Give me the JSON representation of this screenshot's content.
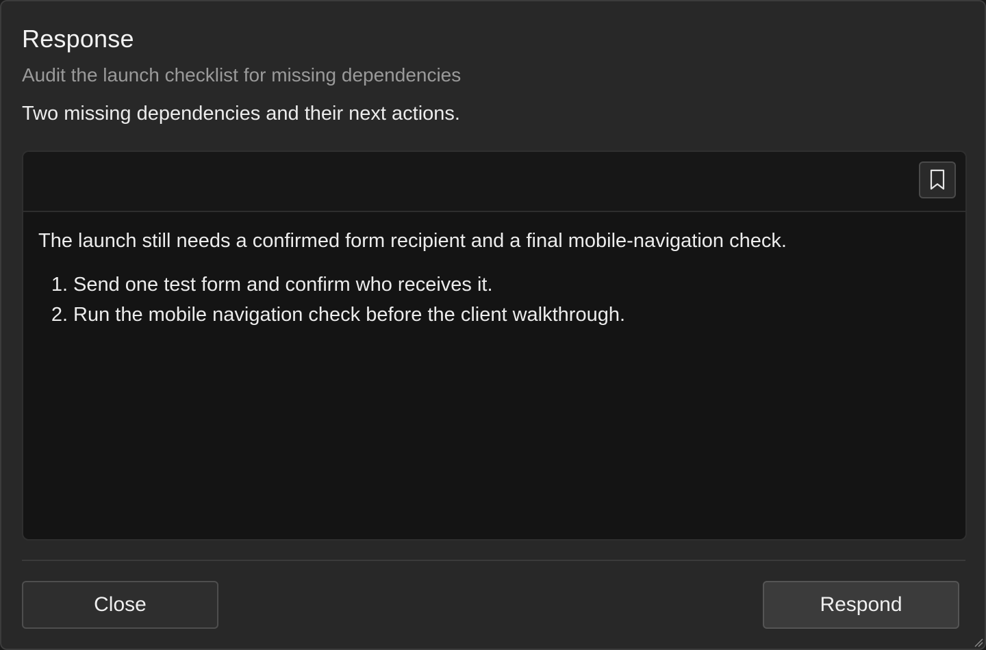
{
  "dialog": {
    "title": "Response",
    "subtitle": "Audit the launch checklist for missing dependencies",
    "summary": "Two missing dependencies and their next actions."
  },
  "panel": {
    "toolbar": {
      "bookmark_icon": "bookmark-icon"
    },
    "intro": "The launch still needs a confirmed form recipient and a final mobile-navigation check.",
    "steps": [
      {
        "num": "1.",
        "text": "Send one test form and confirm who receives it."
      },
      {
        "num": "2.",
        "text": "Run the mobile navigation check before the client walkthrough."
      }
    ]
  },
  "footer": {
    "close_label": "Close",
    "respond_label": "Respond"
  },
  "colors": {
    "dialog_bg": "#282828",
    "panel_bg": "#141414",
    "text_primary": "#ececec",
    "text_muted": "#9a9a9a",
    "button_bg": "#2e2e2e"
  }
}
